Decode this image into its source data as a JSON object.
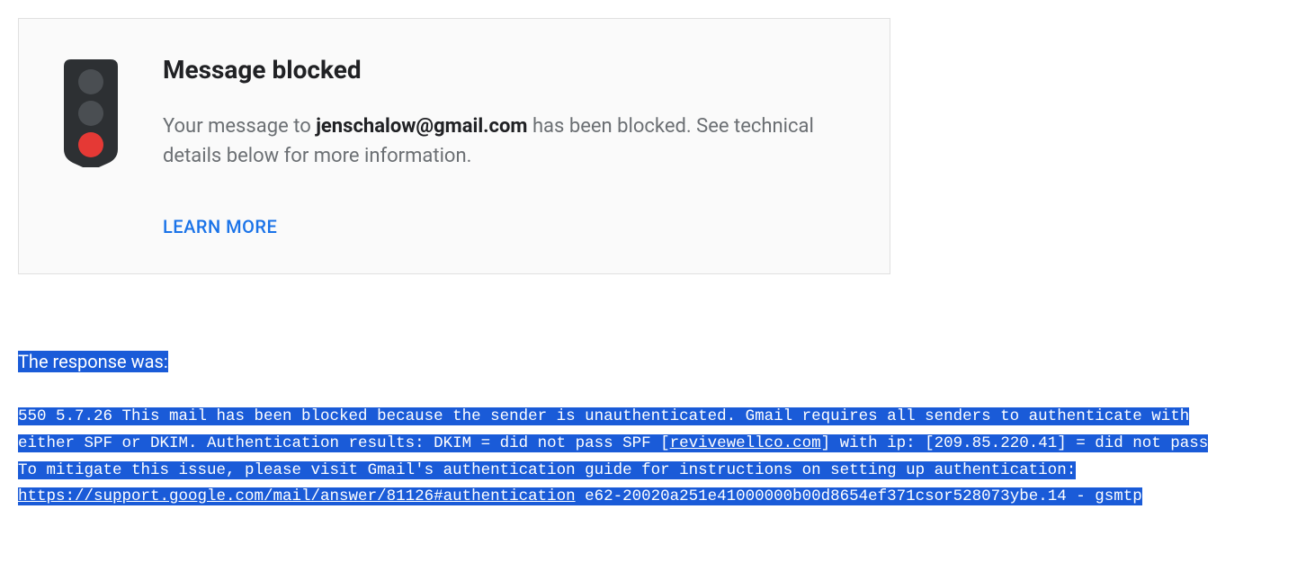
{
  "card": {
    "title": "Message blocked",
    "desc_prefix": "Your message to ",
    "desc_email": "jenschalow@gmail.com",
    "desc_suffix": " has been blocked. See technical details below for more information.",
    "learn_more": "LEARN MORE"
  },
  "technical": {
    "label": "The response was:",
    "line1": "550 5.7.26 This mail has been blocked because the sender is unauthenticated. Gmail requires all senders to authenticate with ",
    "line2a": "either SPF or DKIM. Authentication results: DKIM = did not pass SPF [",
    "line2_link": "revivewellco.com",
    "line2b": "] with ip: [209.85.220.41] = did not pass ",
    "line3": "To mitigate this issue, please visit Gmail's authentication guide for instructions on setting up authentication: ",
    "line4_link": "https://support.google.com/mail/answer/81126#authentication",
    "line4b": " e62-20020a251e41000000b00d8654ef371csor528073ybe.14 - gsmtp"
  }
}
